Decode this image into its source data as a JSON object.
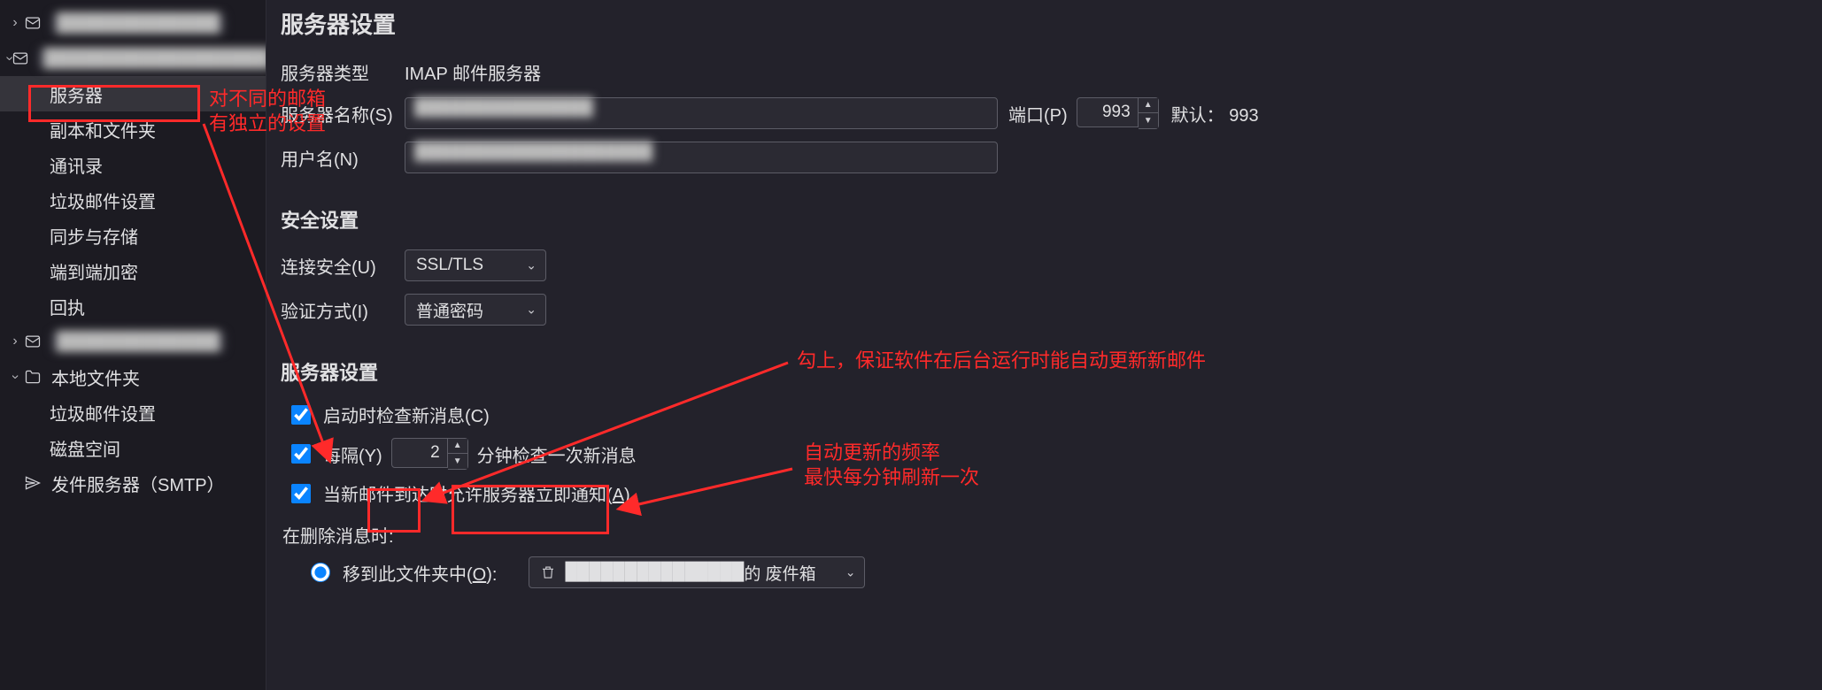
{
  "sidebar": {
    "accounts": [
      {
        "label_redacted": "█████████████",
        "expanded": false
      },
      {
        "label_redacted": "██████████████████",
        "expanded": true,
        "children": [
          {
            "key": "server",
            "label": "服务器",
            "selected": true
          },
          {
            "key": "copies",
            "label": "副本和文件夹"
          },
          {
            "key": "contacts",
            "label": "通讯录"
          },
          {
            "key": "junk",
            "label": "垃圾邮件设置"
          },
          {
            "key": "sync",
            "label": "同步与存储"
          },
          {
            "key": "e2e",
            "label": "端到端加密"
          },
          {
            "key": "receipt",
            "label": "回执"
          }
        ]
      },
      {
        "label_redacted": "█████████████",
        "expanded": false
      }
    ],
    "local": {
      "label": "本地文件夹",
      "children": [
        {
          "key": "junk2",
          "label": "垃圾邮件设置"
        },
        {
          "key": "disk",
          "label": "磁盘空间"
        }
      ]
    },
    "smtp": {
      "label": "发件服务器（SMTP）"
    }
  },
  "main": {
    "title": "服务器设置",
    "server_type_label": "服务器类型",
    "server_type_value": "IMAP 邮件服务器",
    "server_name_label": "服务器名称(S)",
    "server_name_value_redacted": "███████████████",
    "port_label": "端口(P)",
    "port_value": "993",
    "port_default_label": "默认：",
    "port_default_value": "993",
    "username_label": "用户名(N)",
    "username_value_redacted": "████████████████████",
    "security_heading": "安全设置",
    "conn_sec_label": "连接安全(U)",
    "conn_sec_value": "SSL/TLS",
    "auth_label": "验证方式(I)",
    "auth_value": "普通密码",
    "server_settings_heading": "服务器设置",
    "check_startup_label": "启动时检查新消息(C)",
    "check_startup_checked": true,
    "check_interval_prefix": "每隔(Y)",
    "check_interval_value": "2",
    "check_interval_suffix": "分钟检查一次新消息",
    "check_interval_checked": true,
    "notify_label_a": "当新邮件到达时允许服务器立即通知(",
    "notify_label_b": "A",
    "notify_label_c": ")",
    "notify_checked": true,
    "on_delete_label": "在删除消息时:",
    "move_to_label_a": "移到此文件夹中(",
    "move_to_label_b": "O",
    "move_to_label_c": "):",
    "move_to_checked": true,
    "move_to_folder_redacted": "███████████████",
    "move_to_folder_suffix": " 的 废件箱"
  },
  "annotations": {
    "note1_line1": "对不同的邮箱",
    "note1_line2": "有独立的设置",
    "note2": "勾上，保证软件在后台运行时能自动更新新邮件",
    "note3_line1": "自动更新的频率",
    "note3_line2": "最快每分钟刷新一次"
  }
}
